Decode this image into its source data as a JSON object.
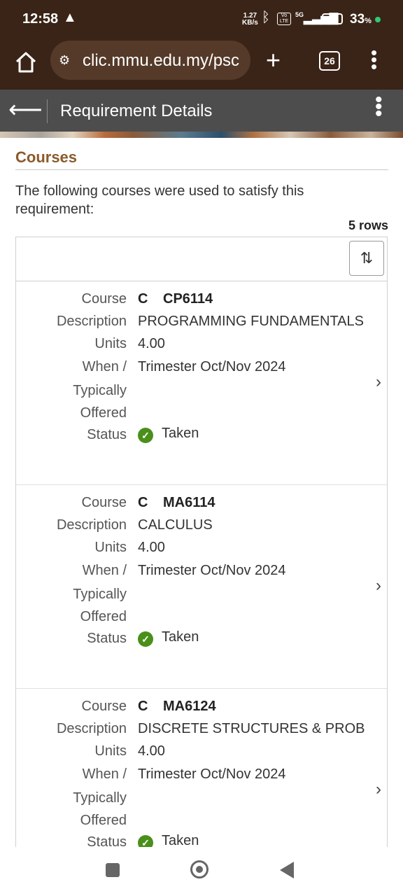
{
  "status_bar": {
    "time": "12:58",
    "warning_icon": "warning-triangle-icon",
    "net_speed_value": "1.27",
    "net_speed_unit": "KB/s",
    "network": "5G",
    "volte": "Vo LTE",
    "battery": "33",
    "battery_unit": "%"
  },
  "browser": {
    "url": "clic.mmu.edu.my/psc",
    "tab_count": "26"
  },
  "header": {
    "title": "Requirement Details"
  },
  "section": {
    "heading": "Courses",
    "intro": "The following courses were used to satisfy this requirement:",
    "row_count": "5 rows"
  },
  "labels": {
    "course": "Course",
    "description": "Description",
    "units": "Units",
    "when1": "When /",
    "when2": "Typically",
    "when3": "Offered",
    "status": "Status"
  },
  "courses": [
    {
      "type": "C",
      "code": "CP6114",
      "description": "PROGRAMMING FUNDAMENTALS",
      "units": "4.00",
      "when": "Trimester Oct/Nov 2024",
      "status": "Taken"
    },
    {
      "type": "C",
      "code": "MA6114",
      "description": "CALCULUS",
      "units": "4.00",
      "when": "Trimester Oct/Nov 2024",
      "status": "Taken"
    },
    {
      "type": "C",
      "code": "MA6124",
      "description": "DISCRETE STRUCTURES & PROB",
      "units": "4.00",
      "when": "Trimester Oct/Nov 2024",
      "status": "Taken"
    }
  ],
  "colors": {
    "accent": "#8b5a2b",
    "status_ok": "#4a8f1a",
    "header_bg": "#4d4d4d"
  }
}
